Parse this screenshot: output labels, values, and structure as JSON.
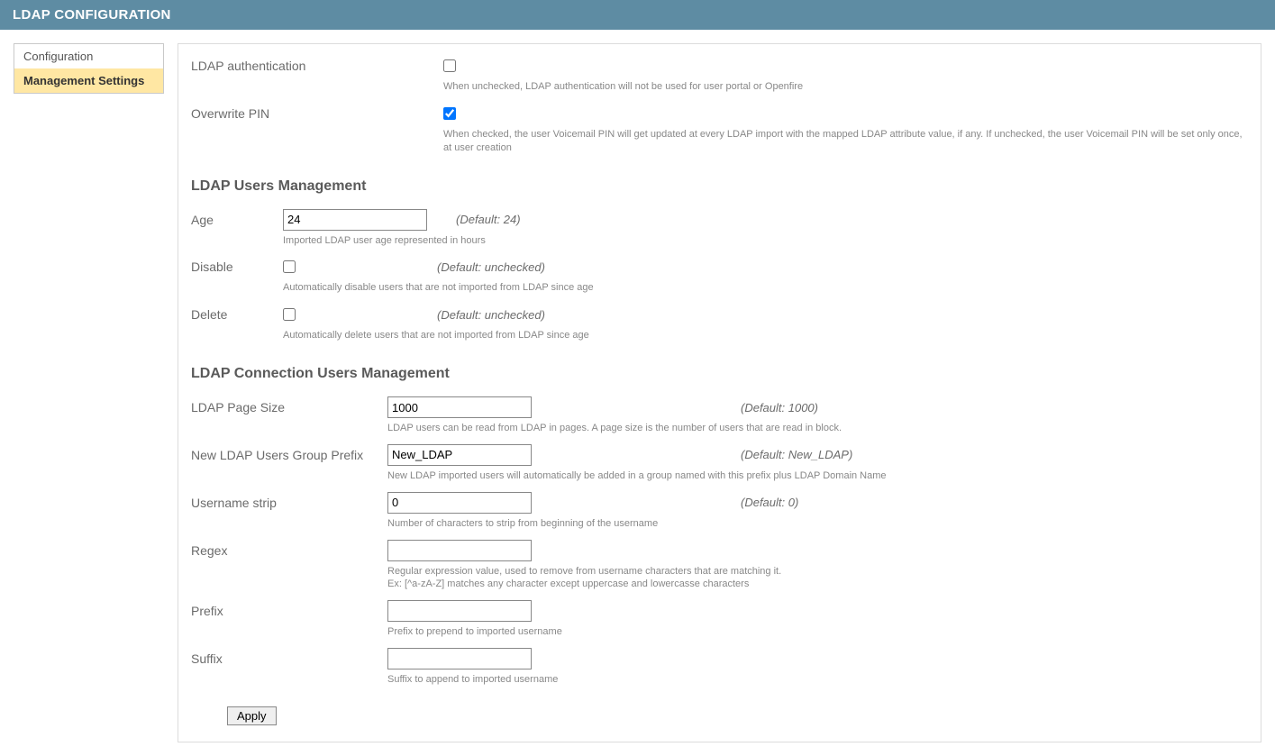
{
  "header": {
    "title": "LDAP CONFIGURATION"
  },
  "sidebar": {
    "items": [
      {
        "label": "Configuration",
        "selected": false
      },
      {
        "label": "Management Settings",
        "selected": true
      }
    ]
  },
  "auth_section": {
    "ldap_auth": {
      "label": "LDAP authentication",
      "checked": false,
      "help": "When unchecked, LDAP authentication will not be used for user portal or Openfire"
    },
    "overwrite_pin": {
      "label": "Overwrite PIN",
      "checked": true,
      "help": "When checked, the user Voicemail PIN will get updated at every LDAP import with the mapped LDAP attribute value, if any. If unchecked, the user Voicemail PIN will be set only once, at user creation"
    }
  },
  "users_mgmt": {
    "title": "LDAP Users Management",
    "age": {
      "label": "Age",
      "value": "24",
      "default": "(Default: 24)",
      "help": "Imported LDAP user age represented in hours"
    },
    "disable": {
      "label": "Disable",
      "checked": false,
      "default": "(Default: unchecked)",
      "help": "Automatically disable users that are not imported from LDAP since age"
    },
    "delete": {
      "label": "Delete",
      "checked": false,
      "default": "(Default: unchecked)",
      "help": "Automatically delete users that are not imported from LDAP since age"
    }
  },
  "conn_mgmt": {
    "title": "LDAP Connection Users Management",
    "page_size": {
      "label": "LDAP Page Size",
      "value": "1000",
      "default": "(Default: 1000)",
      "help": "LDAP users can be read from LDAP in pages. A page size is the number of users that are read in block."
    },
    "group_prefix": {
      "label": "New LDAP Users Group Prefix",
      "value": "New_LDAP",
      "default": "(Default: New_LDAP)",
      "help": "New LDAP imported users will automatically be added in a group named with this prefix plus LDAP Domain Name"
    },
    "username_strip": {
      "label": "Username strip",
      "value": "0",
      "default": "(Default: 0)",
      "help": "Number of characters to strip from beginning of the username"
    },
    "regex": {
      "label": "Regex",
      "value": "",
      "help": "Regular expression value, used to remove from username characters that are matching it.\nEx: [^a-zA-Z] matches any character except uppercase and lowercasse characters"
    },
    "prefix": {
      "label": "Prefix",
      "value": "",
      "help": "Prefix to prepend to imported username"
    },
    "suffix": {
      "label": "Suffix",
      "value": "",
      "help": "Suffix to append to imported username"
    }
  },
  "buttons": {
    "apply": "Apply"
  }
}
